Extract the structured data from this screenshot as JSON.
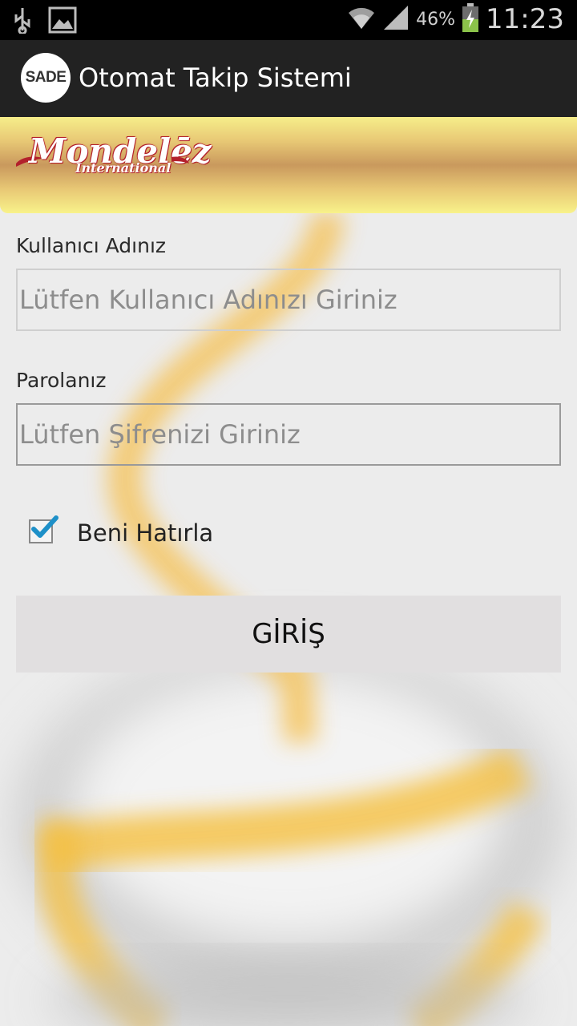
{
  "status_bar": {
    "time": "11:23",
    "battery": "46%",
    "icons": [
      "usb-icon",
      "image-icon",
      "wifi-icon",
      "signal-icon",
      "battery-charging-icon"
    ]
  },
  "action_bar": {
    "logo_text": "SADE",
    "title": "Otomat Takip Sistemi"
  },
  "banner": {
    "brand": "Mondelēz",
    "brand_sub": "International"
  },
  "form": {
    "username_label": "Kullanıcı Adınız",
    "username_placeholder": "Lütfen Kullanıcı Adınızı Giriniz",
    "password_label": "Parolanız",
    "password_placeholder": "Lütfen Şifrenizi Giriniz",
    "remember_label": "Beni Hatırla",
    "remember_checked": true,
    "submit_label": "GİRİŞ"
  },
  "colors": {
    "action_bar": "#222222",
    "banner_gold": "#e8c875",
    "brand_red": "#b3202c",
    "checkbox_accent": "#1e90c8"
  }
}
